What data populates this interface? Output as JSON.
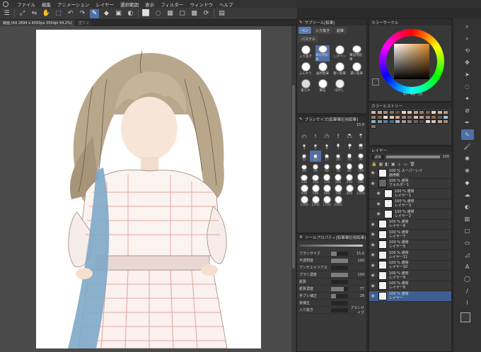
{
  "menu": [
    "ファイル",
    "編集",
    "アニメーション",
    "レイヤー",
    "選択範囲",
    "表示",
    "フィルター",
    "ウィンドウ",
    "ヘルプ"
  ],
  "tabs": {
    "active": "線画 (A4 2894 x 4093px 350dpi 44.2%)",
    "inactive": "塗り 2"
  },
  "sub_tool": {
    "title": "サブツール[鉛筆]",
    "groups": [
      "ペン",
      "入り抜き",
      "鉛筆",
      "パステル"
    ],
    "brushes": [
      {
        "label": "入り抜き"
      },
      {
        "label": "筆記用鉛筆"
      },
      {
        "label": "しげペン"
      },
      {
        "label": "筆記用鉛筆"
      },
      {
        "label": "ふんわり"
      },
      {
        "label": "画材鉛筆"
      },
      {
        "label": "粗い鉛筆"
      },
      {
        "label": "濃い鉛筆"
      },
      {
        "label": "柔らか"
      },
      {
        "label": "筆圧"
      },
      {
        "label": "ぼかし"
      },
      {
        "label": ""
      }
    ]
  },
  "color_wheel": {
    "title": "カラーサークル",
    "h": "47",
    "s": "43",
    "v": "39",
    "main_color": "#3b3b3b",
    "sub_color": "#ffffff"
  },
  "color_history": {
    "title": "カラーヒストリー",
    "swatches": [
      "#d9b3a0",
      "#c7a68f",
      "#a88b77",
      "#8a6f5c",
      "#6b5545",
      "#f2d6c9",
      "#e8c0a9",
      "#c99a85",
      "#a57b68",
      "#7d5c4e",
      "#e3d2c4",
      "#cdb5a2",
      "#b39783",
      "#98816e",
      "#7a6758",
      "#f0e4da",
      "#dbc7b8",
      "#c0a690",
      "#a48672",
      "#86695a",
      "#d5c3b7",
      "#b9a393",
      "#9f8876",
      "#856f60",
      "#6b594d",
      "#a9c4d6",
      "#8fb0c7",
      "#7698b0",
      "#5e8199",
      "#486b82",
      "#b3b3b3",
      "#9a9a9a",
      "#808080",
      "#666666",
      "#4d4d4d",
      "#e6dcd2",
      "#d1c2b3",
      "#bba694",
      "#a38b78",
      "#8b735f"
    ]
  },
  "brush_size": {
    "title": "ブラシサイズ[鉛筆筆記用鉛筆]",
    "value": "15.0",
    "presets": [
      "0.7",
      "1",
      "1.5",
      "2",
      "2.5",
      "3",
      "4",
      "5",
      "6",
      "7",
      "8",
      "10",
      "12",
      "15",
      "17",
      "20",
      "25",
      "30",
      "40",
      "50",
      "60",
      "70",
      "80",
      "100",
      "120",
      "150",
      "170",
      "200",
      "250",
      "300",
      "400",
      "500",
      "600",
      "700",
      "800",
      "1000",
      "1200",
      "1500",
      "1700",
      "2000"
    ]
  },
  "tool_property": {
    "title": "ツールプロパティ[鉛筆筆記用鉛筆]",
    "rows": [
      {
        "label": "ブラシサイズ",
        "value": "15.0",
        "fill": 0.35
      },
      {
        "label": "不透明度",
        "value": "100",
        "fill": 1.0
      },
      {
        "label": "アンチエイリアス",
        "value": "",
        "fill": 0
      },
      {
        "label": "ブラシ濃度",
        "value": "100",
        "fill": 1.0
      },
      {
        "label": "紙質",
        "value": "",
        "fill": 0
      },
      {
        "label": "紙質濃度",
        "value": "77",
        "fill": 0.77
      },
      {
        "label": "手ブレ補正",
        "value": "28",
        "fill": 0.28
      },
      {
        "label": "後補正",
        "value": "",
        "fill": 0
      },
      {
        "label": "入り抜き",
        "value": "ブラシサイズ",
        "fill": 0
      }
    ]
  },
  "layers": {
    "title": "レイヤー",
    "blend": "通常",
    "opacity": "100",
    "items": [
      {
        "pct": "100 %",
        "mode": "スーパーレイ",
        "name": "画用紙"
      },
      {
        "pct": "100 %",
        "mode": "通常",
        "name": "フォルダー1"
      },
      {
        "pct": "100 %",
        "mode": "通常",
        "name": "レイヤー1"
      },
      {
        "pct": "100 %",
        "mode": "通常",
        "name": "レイヤー3"
      },
      {
        "pct": "100 %",
        "mode": "通常",
        "name": "レイヤー2"
      },
      {
        "pct": "100 %",
        "mode": "通常",
        "name": "レイヤー8"
      },
      {
        "pct": "100 %",
        "mode": "通常",
        "name": "レイヤー7"
      },
      {
        "pct": "100 %",
        "mode": "通常",
        "name": "レイヤー5"
      },
      {
        "pct": "100 %",
        "mode": "通常",
        "name": "レイヤー11"
      },
      {
        "pct": "100 %",
        "mode": "通常",
        "name": "レイヤー10"
      },
      {
        "pct": "100 %",
        "mode": "通常",
        "name": "レイヤー9"
      },
      {
        "pct": "100 %",
        "mode": "通常",
        "name": "レイヤー6"
      },
      {
        "pct": "100 %",
        "mode": "通常",
        "name": "レイヤー"
      }
    ]
  }
}
